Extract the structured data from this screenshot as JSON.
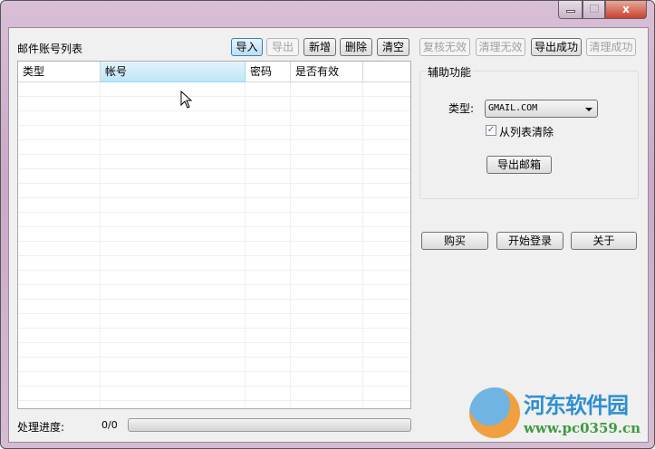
{
  "window": {
    "min": "—",
    "max": "□",
    "close": "x"
  },
  "list": {
    "title": "邮件账号列表",
    "columns": [
      "类型",
      "帐号",
      "密码",
      "是否有效",
      ""
    ]
  },
  "toolbar": {
    "import": "导入",
    "export": "导出",
    "add": "新增",
    "delete": "删除",
    "clear": "清空",
    "recheck_invalid": "复核无效",
    "clean_invalid": "清理无效",
    "export_success": "导出成功",
    "clean_success": "清理成功"
  },
  "aux": {
    "title": "辅助功能",
    "type_label": "类型:",
    "type_value": "GMAIL.COM",
    "remove_from_list": "从列表清除",
    "remove_checked": true,
    "export_mailbox": "导出邮箱"
  },
  "actions": {
    "buy": "购买",
    "start_login": "开始登录",
    "about": "关于"
  },
  "progress": {
    "label": "处理进度:",
    "value": "0/0",
    "fraction": 0
  },
  "watermark": {
    "name": "河东软件园",
    "url": "www.pc0359.cn"
  }
}
